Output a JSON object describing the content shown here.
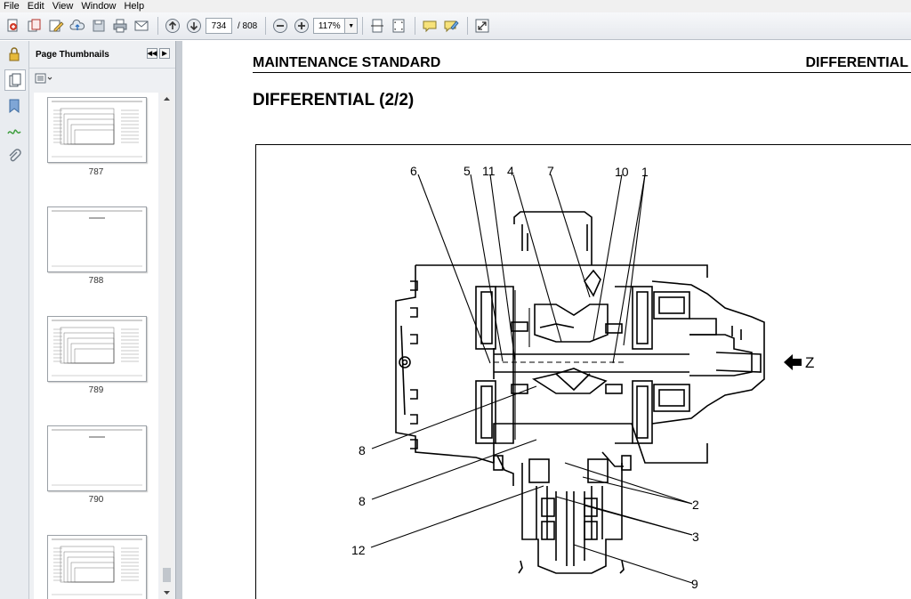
{
  "menu": {
    "items": [
      "File",
      "Edit",
      "View",
      "Window",
      "Help"
    ]
  },
  "toolbar": {
    "current_page": "734",
    "page_count": "/ 808",
    "zoom": "117%"
  },
  "panel": {
    "title": "Page Thumbnails",
    "thumbnails": [
      {
        "page": "787",
        "type": "diagram",
        "caption": ""
      },
      {
        "page": "788",
        "type": "blank",
        "caption": ""
      },
      {
        "page": "789",
        "type": "diagram",
        "caption": ""
      },
      {
        "page": "790",
        "type": "blank",
        "caption": ""
      },
      {
        "page": "",
        "type": "diagram",
        "caption": ""
      }
    ]
  },
  "document": {
    "section": "MAINTENANCE STANDARD",
    "chapter": "DIFFERENTIAL",
    "title": "DIFFERENTIAL (2/2)",
    "callouts": {
      "c6": "6",
      "c5": "5",
      "c11": "11",
      "c4": "4",
      "c7": "7",
      "c10": "10",
      "c1": "1",
      "c8a": "8",
      "c8b": "8",
      "c12": "12",
      "c2": "2",
      "c3": "3",
      "c9": "9",
      "z": "Z"
    }
  },
  "colors": {
    "toolbar_bg": "#e6e9ee",
    "panel_bg": "#eef0f3",
    "accent_blue": "#2a6ebf",
    "accent_green": "#3f9e3f"
  }
}
